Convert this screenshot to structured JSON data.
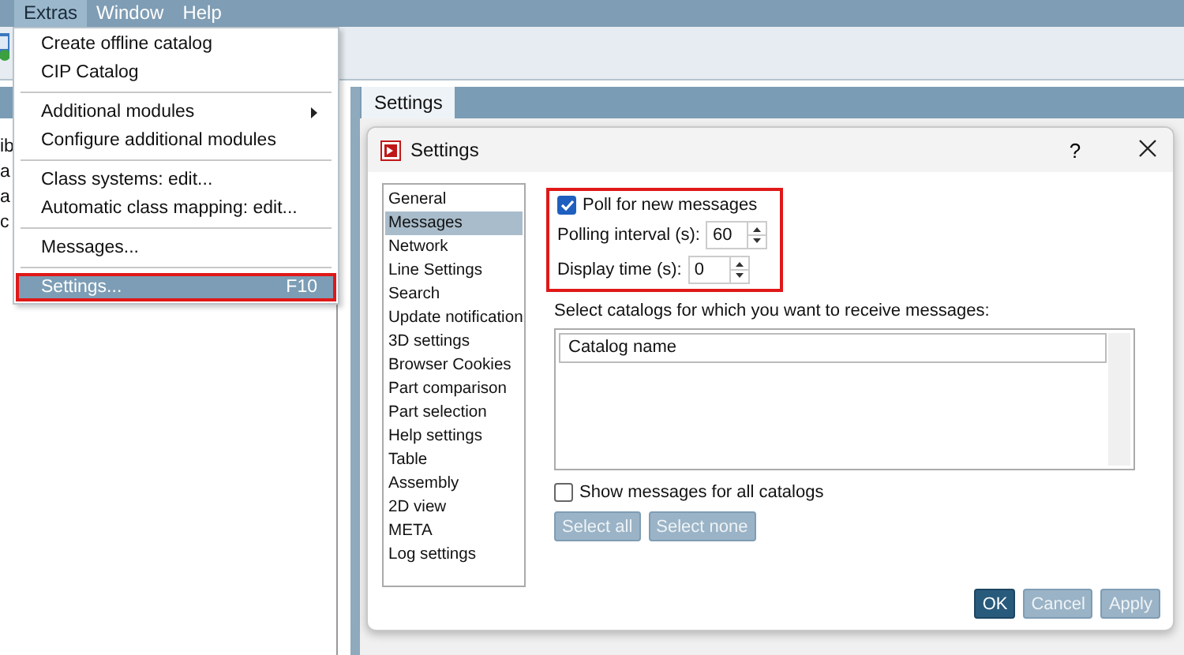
{
  "menubar": {
    "items": [
      {
        "label": "Extras",
        "selected": true
      },
      {
        "label": "Window",
        "selected": false
      },
      {
        "label": "Help",
        "selected": false
      }
    ]
  },
  "left_panel": {
    "items": [
      "ib",
      "a",
      "a",
      "c"
    ]
  },
  "extras_menu": {
    "groups": [
      [
        {
          "label": "Create offline catalog",
          "submenu": false,
          "selected": false
        },
        {
          "label": "CIP Catalog",
          "submenu": false,
          "selected": false
        }
      ],
      [
        {
          "label": "Additional modules",
          "submenu": true,
          "selected": false
        },
        {
          "label": "Configure additional modules",
          "submenu": false,
          "selected": false
        }
      ],
      [
        {
          "label": "Class systems: edit...",
          "submenu": false,
          "selected": false
        },
        {
          "label": "Automatic class mapping: edit...",
          "submenu": false,
          "selected": false
        }
      ],
      [
        {
          "label": "Messages...",
          "submenu": false,
          "selected": false
        }
      ],
      [
        {
          "label": "Settings...",
          "shortcut": "F10",
          "submenu": false,
          "selected": true
        }
      ]
    ]
  },
  "document_tabs": [
    {
      "label": "Settings",
      "selected": true
    }
  ],
  "dialog": {
    "title": "Settings",
    "help_button": "?",
    "categories": [
      {
        "label": "General",
        "selected": false
      },
      {
        "label": "Messages",
        "selected": true
      },
      {
        "label": "Network",
        "selected": false
      },
      {
        "label": "Line Settings",
        "selected": false
      },
      {
        "label": "Search",
        "selected": false
      },
      {
        "label": "Update notification",
        "selected": false
      },
      {
        "label": "3D settings",
        "selected": false
      },
      {
        "label": "Browser Cookies",
        "selected": false
      },
      {
        "label": "Part comparison",
        "selected": false
      },
      {
        "label": "Part selection",
        "selected": false
      },
      {
        "label": "Help settings",
        "selected": false
      },
      {
        "label": "Table",
        "selected": false
      },
      {
        "label": "Assembly",
        "selected": false
      },
      {
        "label": "2D view",
        "selected": false
      },
      {
        "label": "META",
        "selected": false
      },
      {
        "label": "Log settings",
        "selected": false
      }
    ],
    "polling": {
      "highlighted": true,
      "poll": {
        "label": "Poll for new messages",
        "checked": true
      },
      "polling_interval": {
        "label": "Polling interval (s):",
        "value": "60"
      },
      "display_time": {
        "label": "Display time (s):",
        "value": "0"
      }
    },
    "catalogs_label": "Select catalogs for which you want to receive messages:",
    "catalog_table": {
      "columns": [
        "Catalog name"
      ]
    },
    "show_all": {
      "label": "Show messages for all catalogs",
      "checked": false
    },
    "select_buttons": [
      {
        "label": "Select all",
        "disabled": true
      },
      {
        "label": "Select none",
        "disabled": true
      }
    ],
    "footer_buttons": [
      {
        "label": "OK",
        "disabled": false
      },
      {
        "label": "Cancel",
        "disabled": true
      },
      {
        "label": "Apply",
        "disabled": true
      }
    ]
  }
}
